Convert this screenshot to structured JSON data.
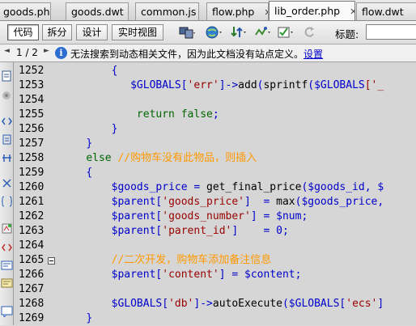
{
  "tabs": [
    {
      "label": "goods.php",
      "active": false
    },
    {
      "label": "goods.dwt",
      "active": false
    },
    {
      "label": "common.js",
      "active": false
    },
    {
      "label": "flow.php",
      "active": false
    },
    {
      "label": "lib_order.php",
      "active": true
    },
    {
      "label": "flow.dwt",
      "active": false
    }
  ],
  "toolbar": {
    "code_label": "代码",
    "split_label": "拆分",
    "design_label": "设计",
    "live_label": "实时视图",
    "title_label": "标题:",
    "title_value": ""
  },
  "infobar": {
    "pager": "1 / 2",
    "message": "无法搜索到动态相关文件，因为此文档没有站点定义。",
    "link": "设置"
  },
  "editor": {
    "lines": [
      {
        "num": "1252",
        "fold": false,
        "tokens": [
          {
            "t": "        ",
            "c": "d"
          },
          {
            "t": "{",
            "c": "p"
          }
        ]
      },
      {
        "num": "1253",
        "fold": false,
        "tokens": [
          {
            "t": "           ",
            "c": "d"
          },
          {
            "t": "$GLOBALS",
            "c": "v"
          },
          {
            "t": "[",
            "c": "p"
          },
          {
            "t": "'err'",
            "c": "s"
          },
          {
            "t": "]->",
            "c": "p"
          },
          {
            "t": "add",
            "c": "f"
          },
          {
            "t": "(",
            "c": "p"
          },
          {
            "t": "sprintf",
            "c": "f"
          },
          {
            "t": "(",
            "c": "p"
          },
          {
            "t": "$GLOBALS",
            "c": "v"
          },
          {
            "t": "['_",
            "c": "s"
          }
        ]
      },
      {
        "num": "1254",
        "fold": false,
        "tokens": []
      },
      {
        "num": "1255",
        "fold": false,
        "tokens": [
          {
            "t": "            ",
            "c": "d"
          },
          {
            "t": "return false",
            "c": "k"
          },
          {
            "t": ";",
            "c": "p"
          }
        ]
      },
      {
        "num": "1256",
        "fold": false,
        "tokens": [
          {
            "t": "        ",
            "c": "d"
          },
          {
            "t": "}",
            "c": "p"
          }
        ]
      },
      {
        "num": "1257",
        "fold": false,
        "tokens": [
          {
            "t": "    ",
            "c": "d"
          },
          {
            "t": "}",
            "c": "p"
          }
        ]
      },
      {
        "num": "1258",
        "fold": false,
        "tokens": [
          {
            "t": "    ",
            "c": "d"
          },
          {
            "t": "else",
            "c": "k"
          },
          {
            "t": " ",
            "c": "d"
          },
          {
            "t": "//购物车没有此物品，则插入",
            "c": "c"
          }
        ]
      },
      {
        "num": "1259",
        "fold": false,
        "tokens": [
          {
            "t": "    ",
            "c": "d"
          },
          {
            "t": "{",
            "c": "p"
          }
        ]
      },
      {
        "num": "1260",
        "fold": false,
        "tokens": [
          {
            "t": "        ",
            "c": "d"
          },
          {
            "t": "$goods_price",
            "c": "v"
          },
          {
            "t": " = ",
            "c": "p"
          },
          {
            "t": "get_final_price",
            "c": "f"
          },
          {
            "t": "(",
            "c": "p"
          },
          {
            "t": "$goods_id",
            "c": "v"
          },
          {
            "t": ", ",
            "c": "p"
          },
          {
            "t": "$",
            "c": "v"
          }
        ]
      },
      {
        "num": "1261",
        "fold": false,
        "tokens": [
          {
            "t": "        ",
            "c": "d"
          },
          {
            "t": "$parent",
            "c": "v"
          },
          {
            "t": "[",
            "c": "p"
          },
          {
            "t": "'goods_price'",
            "c": "s"
          },
          {
            "t": "]  = ",
            "c": "p"
          },
          {
            "t": "max",
            "c": "f"
          },
          {
            "t": "(",
            "c": "p"
          },
          {
            "t": "$goods_price",
            "c": "v"
          },
          {
            "t": ",",
            "c": "p"
          }
        ]
      },
      {
        "num": "1262",
        "fold": false,
        "tokens": [
          {
            "t": "        ",
            "c": "d"
          },
          {
            "t": "$parent",
            "c": "v"
          },
          {
            "t": "[",
            "c": "p"
          },
          {
            "t": "'goods_number'",
            "c": "s"
          },
          {
            "t": "] = ",
            "c": "p"
          },
          {
            "t": "$num",
            "c": "v"
          },
          {
            "t": ";",
            "c": "p"
          }
        ]
      },
      {
        "num": "1263",
        "fold": false,
        "tokens": [
          {
            "t": "        ",
            "c": "d"
          },
          {
            "t": "$parent",
            "c": "v"
          },
          {
            "t": "[",
            "c": "p"
          },
          {
            "t": "'parent_id'",
            "c": "s"
          },
          {
            "t": "]    = ",
            "c": "p"
          },
          {
            "t": "0",
            "c": "p"
          },
          {
            "t": ";",
            "c": "p"
          }
        ]
      },
      {
        "num": "1264",
        "fold": false,
        "tokens": []
      },
      {
        "num": "1265",
        "fold": true,
        "tokens": [
          {
            "t": "        ",
            "c": "d"
          },
          {
            "t": "//二次开发，购物车添加备注信息",
            "c": "c"
          }
        ]
      },
      {
        "num": "1266",
        "fold": false,
        "tokens": [
          {
            "t": "        ",
            "c": "d"
          },
          {
            "t": "$parent",
            "c": "v"
          },
          {
            "t": "[",
            "c": "p"
          },
          {
            "t": "'content'",
            "c": "s"
          },
          {
            "t": "] = ",
            "c": "p"
          },
          {
            "t": "$content",
            "c": "v"
          },
          {
            "t": ";",
            "c": "p"
          }
        ]
      },
      {
        "num": "1267",
        "fold": false,
        "tokens": []
      },
      {
        "num": "1268",
        "fold": false,
        "tokens": [
          {
            "t": "        ",
            "c": "d"
          },
          {
            "t": "$GLOBALS",
            "c": "v"
          },
          {
            "t": "[",
            "c": "p"
          },
          {
            "t": "'db'",
            "c": "s"
          },
          {
            "t": "]->",
            "c": "p"
          },
          {
            "t": "autoExecute",
            "c": "f"
          },
          {
            "t": "(",
            "c": "p"
          },
          {
            "t": "$GLOBALS",
            "c": "v"
          },
          {
            "t": "[",
            "c": "p"
          },
          {
            "t": "'ecs'",
            "c": "s"
          },
          {
            "t": "]",
            "c": "p"
          }
        ]
      },
      {
        "num": "1269",
        "fold": false,
        "tokens": [
          {
            "t": "    ",
            "c": "d"
          },
          {
            "t": "}",
            "c": "p"
          }
        ]
      }
    ]
  },
  "colors": {
    "punctuation": "#0000cc",
    "string": "#990000",
    "variable": "#0000cc",
    "keyword": "#006600",
    "comment": "#ff9900",
    "editor_bg": "#d6d6d6"
  },
  "icons": {
    "toolbar": [
      "multiscreen-icon",
      "globe-icon",
      "file-transfer-icon",
      "debug-icon",
      "validate-icon",
      "refresh-icon"
    ],
    "sidebar": [
      "open-document-icon",
      "collapse-icon",
      "expand-tag-icon",
      "select-parent-icon",
      "balance-braces-icon",
      "line-numbers-icon",
      "highlight-invalid-icon",
      "syntax-error-icon",
      "wrap-tag-icon",
      "apply-comment-icon",
      "remove-comment-icon",
      "snippet-icon"
    ]
  }
}
